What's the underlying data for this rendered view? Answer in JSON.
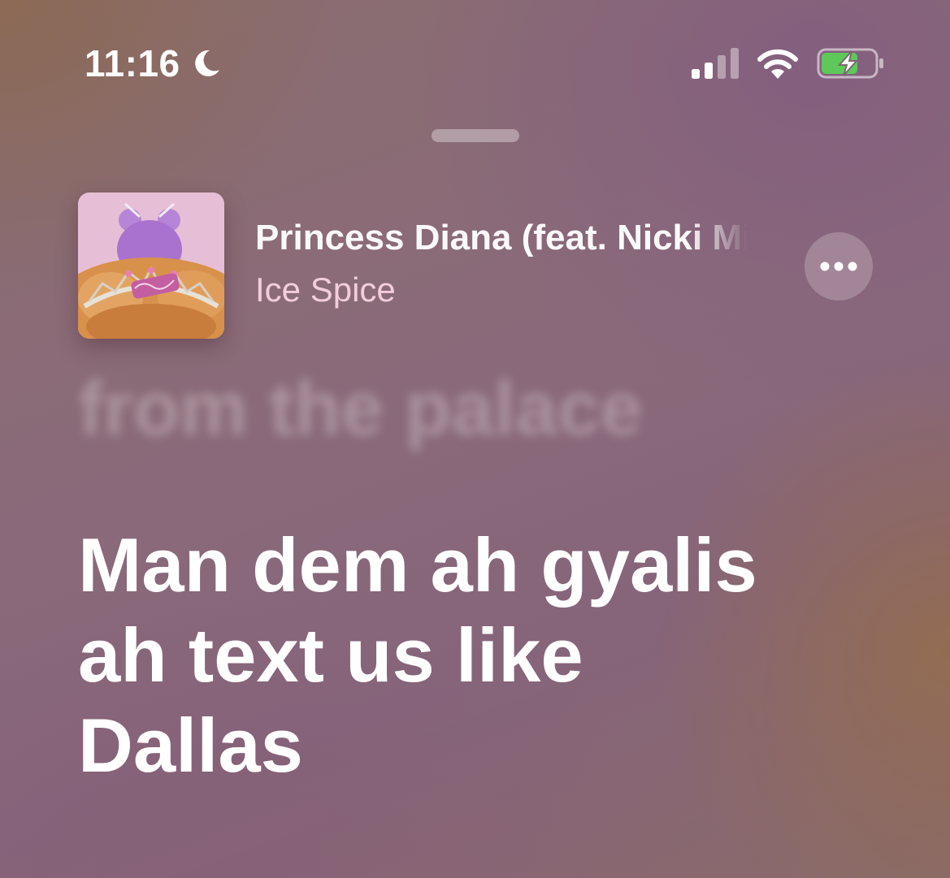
{
  "status_bar": {
    "time": "11:16",
    "focus_icon": "moon-icon",
    "signal_icon": "cellular-signal-icon",
    "wifi_icon": "wifi-icon",
    "battery_icon": "battery-charging-icon",
    "battery_color": "#5ec95a"
  },
  "sheet": {
    "grabber_icon": "sheet-grabber"
  },
  "now_playing": {
    "title": "Princess Diana (feat. Nicki Minaj)",
    "artist": "Ice Spice",
    "artist_color": "#f3cddd",
    "more_icon": "ellipsis-icon"
  },
  "lyrics": {
    "previous_line": "from the palace",
    "current_line": "Man dem ah gyalis ah text us like Dallas"
  }
}
